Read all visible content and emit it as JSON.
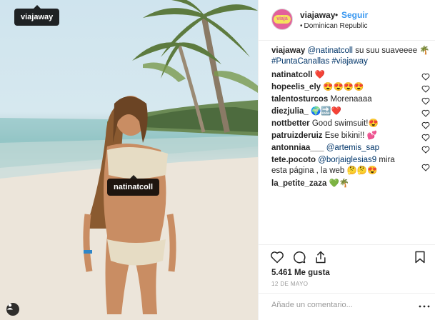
{
  "photo": {
    "tags": {
      "viajaway": "viajaway",
      "natinatcoll": "natinatcoll"
    }
  },
  "header": {
    "username": "viajaway",
    "separator": "•",
    "follow_label": "Seguir",
    "location_lead": "•",
    "location": "Dominican Republic",
    "avatar_text": "viaja"
  },
  "caption": {
    "username": "viajaway",
    "mention": "@natinatcoll",
    "text": " su suu suaveeee 🌴",
    "hashtags": "#PuntaCanallas #viajaway"
  },
  "comments": [
    {
      "user": "natinatcoll",
      "text": " ❤️"
    },
    {
      "user": "hopeelis_ely",
      "text": " 😍😍😍😍"
    },
    {
      "user": "talentosturcos",
      "text": " Morenaaaa"
    },
    {
      "user": "diezjulia_",
      "text": " 🌍🔜❤️"
    },
    {
      "user": "nottbetter",
      "text": " Good swimsuit!😍"
    },
    {
      "user": "patruizderuiz",
      "text": " Ese bikini!! 💕"
    },
    {
      "user": "antonniaa___",
      "mention": " @artemis_sap",
      "text": ""
    },
    {
      "user": "tete.pocoto",
      "mention": " @borjaiglesias9",
      "text": " mira esta página , la web 🤔🤔😍"
    },
    {
      "user": "la_petite_zaza",
      "text": " 💚🌴"
    }
  ],
  "actions": {
    "like_icon": "heart-icon",
    "comment_icon": "comment-icon",
    "share_icon": "share-icon",
    "save_icon": "bookmark-icon"
  },
  "likes": "5.461 Me gusta",
  "date": "12 DE MAYO",
  "add_comment": {
    "placeholder": "Añade un comentario..."
  },
  "colors": {
    "link": "#3897f0",
    "mention": "#003569",
    "border": "#efefef"
  }
}
